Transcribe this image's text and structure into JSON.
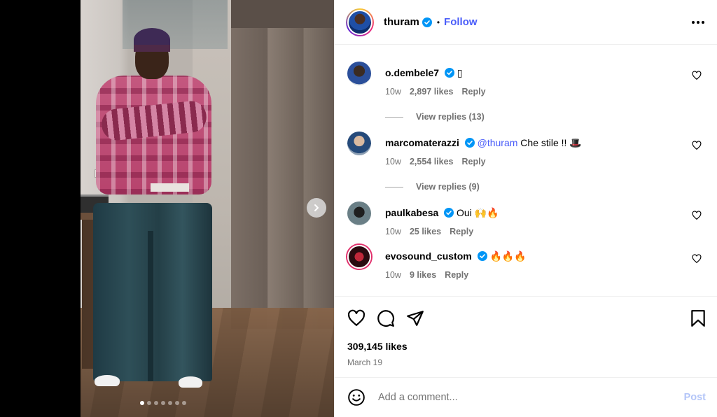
{
  "header": {
    "username": "thuram",
    "separator": "•",
    "follow_label": "Follow"
  },
  "comments": [
    {
      "username": "o.dembele7",
      "text": "",
      "emoji": "▯",
      "age": "10w",
      "likes": "2,897 likes",
      "reply": "Reply",
      "view_replies": "View replies (13)"
    },
    {
      "username": "marcomaterazzi",
      "mention": "@thuram",
      "text": " Che stile !! ",
      "emoji": "🎩",
      "age": "10w",
      "likes": "2,554 likes",
      "reply": "Reply",
      "view_replies": "View replies (9)"
    },
    {
      "username": "paulkabesa",
      "text": "Oui ",
      "emoji": "🙌🔥",
      "age": "10w",
      "likes": "25 likes",
      "reply": "Reply"
    },
    {
      "username": "evosound_custom",
      "text": "",
      "emoji": "🔥🔥🔥",
      "age": "10w",
      "likes": "9 likes",
      "reply": "Reply"
    }
  ],
  "post": {
    "likes": "309,145 likes",
    "date": "March 19"
  },
  "composer": {
    "placeholder": "Add a comment...",
    "post_label": "Post"
  },
  "carousel": {
    "count": 7,
    "active_index": 0
  },
  "colors": {
    "link": "#4a5df9",
    "verified": "#0095f6",
    "muted": "#737373"
  }
}
